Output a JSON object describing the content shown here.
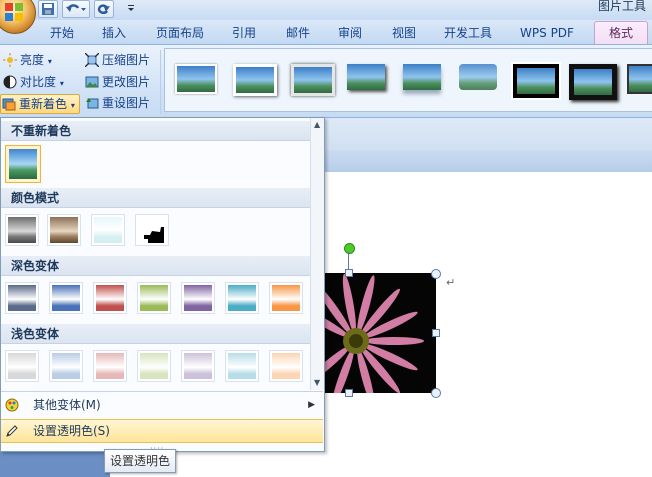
{
  "app": {
    "context_tab_label": "图片工具"
  },
  "tabs": [
    {
      "label": "开始"
    },
    {
      "label": "插入"
    },
    {
      "label": "页面布局"
    },
    {
      "label": "引用"
    },
    {
      "label": "邮件"
    },
    {
      "label": "审阅"
    },
    {
      "label": "视图"
    },
    {
      "label": "开发工具"
    },
    {
      "label": "WPS PDF"
    },
    {
      "label": "格式",
      "active": true
    }
  ],
  "ribbon": {
    "adjust": {
      "brightness": "亮度",
      "contrast": "对比度",
      "recolor": "重新着色",
      "compress": "压缩图片",
      "change_picture": "更改图片",
      "reset_picture": "重设图片"
    },
    "styles_count": 9
  },
  "recolor_menu": {
    "sections": [
      {
        "title": "不重新着色"
      },
      {
        "title": "颜色模式"
      },
      {
        "title": "深色变体"
      },
      {
        "title": "浅色变体"
      }
    ],
    "dark_variant_colors": [
      "#5a6a8a",
      "#4a72b8",
      "#c0504d",
      "#9bbb59",
      "#8064a2",
      "#4bacc6",
      "#f79646"
    ],
    "light_variant_colors": [
      "#d8d8d8",
      "#b9cde5",
      "#e6b9b8",
      "#d7e4bd",
      "#ccc1da",
      "#b7dde8",
      "#fcd5b5"
    ],
    "more_variants": "其他变体(M)",
    "set_transparent_color": "设置透明色(S)"
  },
  "tooltip": {
    "text": "设置透明色"
  },
  "colors": {
    "accent": "#15428b",
    "hover": "#ffe49a"
  }
}
